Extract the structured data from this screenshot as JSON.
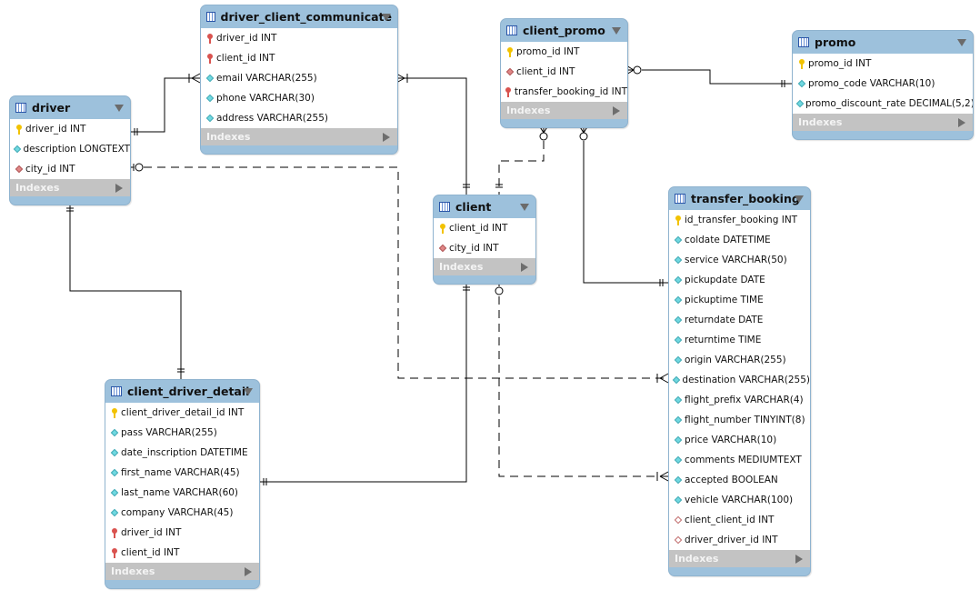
{
  "tables": [
    {
      "name": "driver",
      "columns": [
        {
          "text": "driver_id INT",
          "icon": "pk-key"
        },
        {
          "text": "description LONGTEXT",
          "icon": "column-diamond"
        },
        {
          "text": "city_id INT",
          "icon": "fk-diamond"
        }
      ]
    },
    {
      "name": "driver_client_communicate",
      "columns": [
        {
          "text": "driver_id INT",
          "icon": "fk-key"
        },
        {
          "text": "client_id INT",
          "icon": "fk-key"
        },
        {
          "text": "email VARCHAR(255)",
          "icon": "column-diamond"
        },
        {
          "text": "phone VARCHAR(30)",
          "icon": "column-diamond"
        },
        {
          "text": "address VARCHAR(255)",
          "icon": "column-diamond"
        }
      ]
    },
    {
      "name": "client_promo",
      "columns": [
        {
          "text": "promo_id INT",
          "icon": "pk-key"
        },
        {
          "text": "client_id INT",
          "icon": "fk-diamond"
        },
        {
          "text": "transfer_booking_id INT",
          "icon": "fk-key"
        }
      ]
    },
    {
      "name": "promo",
      "columns": [
        {
          "text": "promo_id INT",
          "icon": "pk-key"
        },
        {
          "text": "promo_code VARCHAR(10)",
          "icon": "column-diamond"
        },
        {
          "text": "promo_discount_rate DECIMAL(5,2)",
          "icon": "column-diamond"
        }
      ]
    },
    {
      "name": "client",
      "columns": [
        {
          "text": "client_id INT",
          "icon": "pk-key"
        },
        {
          "text": "city_id INT",
          "icon": "fk-diamond"
        }
      ]
    },
    {
      "name": "transfer_booking",
      "columns": [
        {
          "text": "id_transfer_booking INT",
          "icon": "pk-key"
        },
        {
          "text": "coldate DATETIME",
          "icon": "column-diamond"
        },
        {
          "text": "service VARCHAR(50)",
          "icon": "column-diamond"
        },
        {
          "text": "pickupdate DATE",
          "icon": "column-diamond"
        },
        {
          "text": "pickuptime TIME",
          "icon": "column-diamond"
        },
        {
          "text": "returndate DATE",
          "icon": "column-diamond"
        },
        {
          "text": "returntime TIME",
          "icon": "column-diamond"
        },
        {
          "text": "origin VARCHAR(255)",
          "icon": "column-diamond"
        },
        {
          "text": "destination VARCHAR(255)",
          "icon": "column-diamond"
        },
        {
          "text": "flight_prefix VARCHAR(4)",
          "icon": "column-diamond"
        },
        {
          "text": "flight_number TINYINT(8)",
          "icon": "column-diamond"
        },
        {
          "text": "price VARCHAR(10)",
          "icon": "column-diamond"
        },
        {
          "text": "comments MEDIUMTEXT",
          "icon": "column-diamond"
        },
        {
          "text": "accepted BOOLEAN",
          "icon": "column-diamond"
        },
        {
          "text": "vehicle VARCHAR(100)",
          "icon": "column-diamond"
        },
        {
          "text": "client_client_id INT",
          "icon": "nullable-fk-diamond"
        },
        {
          "text": "driver_driver_id INT",
          "icon": "nullable-fk-diamond"
        }
      ]
    },
    {
      "name": "client_driver_detail",
      "columns": [
        {
          "text": "client_driver_detail_id INT",
          "icon": "pk-key"
        },
        {
          "text": "pass VARCHAR(255)",
          "icon": "column-diamond"
        },
        {
          "text": "date_inscription DATETIME",
          "icon": "column-diamond"
        },
        {
          "text": "first_name VARCHAR(45)",
          "icon": "column-diamond"
        },
        {
          "text": "last_name VARCHAR(60)",
          "icon": "column-diamond"
        },
        {
          "text": "company VARCHAR(45)",
          "icon": "column-diamond"
        },
        {
          "text": "driver_id INT",
          "icon": "fk-key"
        },
        {
          "text": "client_id INT",
          "icon": "fk-key"
        }
      ]
    }
  ],
  "indexes_label": "Indexes",
  "colors": {
    "header": "#9dc1dc",
    "indexes": "#c3c3c3",
    "pk_key": "#f2c200",
    "fk_key": "#d9534f",
    "column": "#6fd8e0",
    "fk_column": "#e08686"
  }
}
